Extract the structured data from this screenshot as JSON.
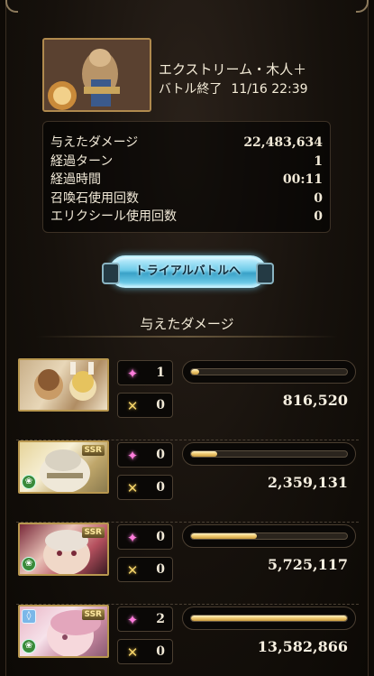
{
  "quest": {
    "title": "エクストリーム・木人＋",
    "status": "バトル終了",
    "datetime": "11/16 22:39"
  },
  "stats": [
    {
      "label": "与えたダメージ",
      "value": "22,483,634"
    },
    {
      "label": "経過ターン",
      "value": "1"
    },
    {
      "label": "経過時間",
      "value": "00:11"
    },
    {
      "label": "召喚石使用回数",
      "value": "0"
    },
    {
      "label": "エリクシール使用回数",
      "value": "0"
    }
  ],
  "trial_button": "トライアルバトルへ",
  "section_title": "与えたダメージ",
  "characters": [
    {
      "skill_count": "1",
      "ability_count": "0",
      "damage": "816,520",
      "bar_fraction": 0.05,
      "badge": "",
      "element_icon": false,
      "lamp_icon": false
    },
    {
      "skill_count": "0",
      "ability_count": "0",
      "damage": "2,359,131",
      "bar_fraction": 0.17,
      "badge": "SSR",
      "element_icon": true,
      "lamp_icon": false
    },
    {
      "skill_count": "0",
      "ability_count": "0",
      "damage": "5,725,117",
      "bar_fraction": 0.42,
      "badge": "SSR",
      "element_icon": true,
      "lamp_icon": false
    },
    {
      "skill_count": "2",
      "ability_count": "0",
      "damage": "13,582,866",
      "bar_fraction": 1.0,
      "badge": "SSR",
      "element_icon": true,
      "lamp_icon": true
    }
  ],
  "icons": {
    "skill": "sparkle-icon",
    "ability": "crossed-swords-icon",
    "element": "wind-element-icon",
    "lamp": "water-element-icon"
  },
  "colors": {
    "accent_gold": "#f0c970",
    "trial_button": "#6ecbe9",
    "skill_icon": "#ff7ddc"
  }
}
